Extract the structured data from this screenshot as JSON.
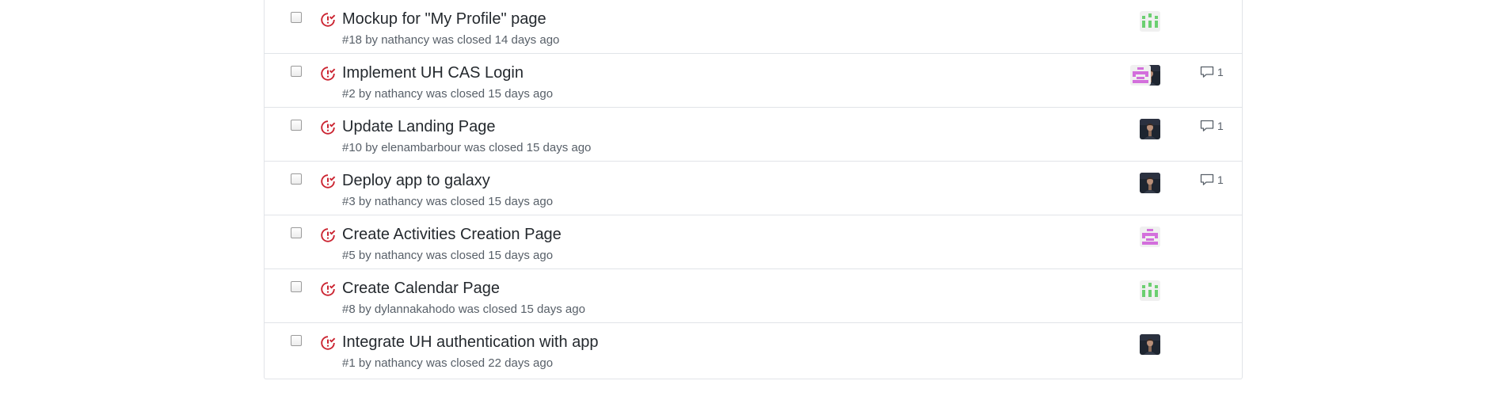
{
  "issues": [
    {
      "title": "Mockup for \"My Profile\" page",
      "number": "#18",
      "author": "nathancy",
      "closed_text": "was closed 14 days ago",
      "assignees": [
        "green-identicon"
      ],
      "comments": ""
    },
    {
      "title": "Implement UH CAS Login",
      "number": "#2",
      "author": "nathancy",
      "closed_text": "was closed 15 days ago",
      "assignees": [
        "dark-photo-avatar",
        "pink-identicon"
      ],
      "comments": "1"
    },
    {
      "title": "Update Landing Page",
      "number": "#10",
      "author": "elenambarbour",
      "closed_text": "was closed 15 days ago",
      "assignees": [
        "dark-photo-avatar"
      ],
      "comments": "1"
    },
    {
      "title": "Deploy app to galaxy",
      "number": "#3",
      "author": "nathancy",
      "closed_text": "was closed 15 days ago",
      "assignees": [
        "dark-photo-avatar"
      ],
      "comments": "1"
    },
    {
      "title": "Create Activities Creation Page",
      "number": "#5",
      "author": "nathancy",
      "closed_text": "was closed 15 days ago",
      "assignees": [
        "pink-identicon"
      ],
      "comments": ""
    },
    {
      "title": "Create Calendar Page",
      "number": "#8",
      "author": "dylannakahodo",
      "closed_text": "was closed 15 days ago",
      "assignees": [
        "green-identicon"
      ],
      "comments": ""
    },
    {
      "title": "Integrate UH authentication with app",
      "number": "#1",
      "author": "nathancy",
      "closed_text": "was closed 22 days ago",
      "assignees": [
        "dark-photo-avatar"
      ],
      "comments": ""
    }
  ],
  "icons": {
    "closed_issue": "issue-closed-icon",
    "comment": "comment-icon"
  },
  "colors": {
    "closed_red": "#cb2431",
    "green_identicon": "#6ccf71",
    "pink_identicon": "#d36fdc",
    "dark_avatar_bg": "#1e2530",
    "meta_gray": "#586069",
    "border": "#e1e4e8"
  }
}
